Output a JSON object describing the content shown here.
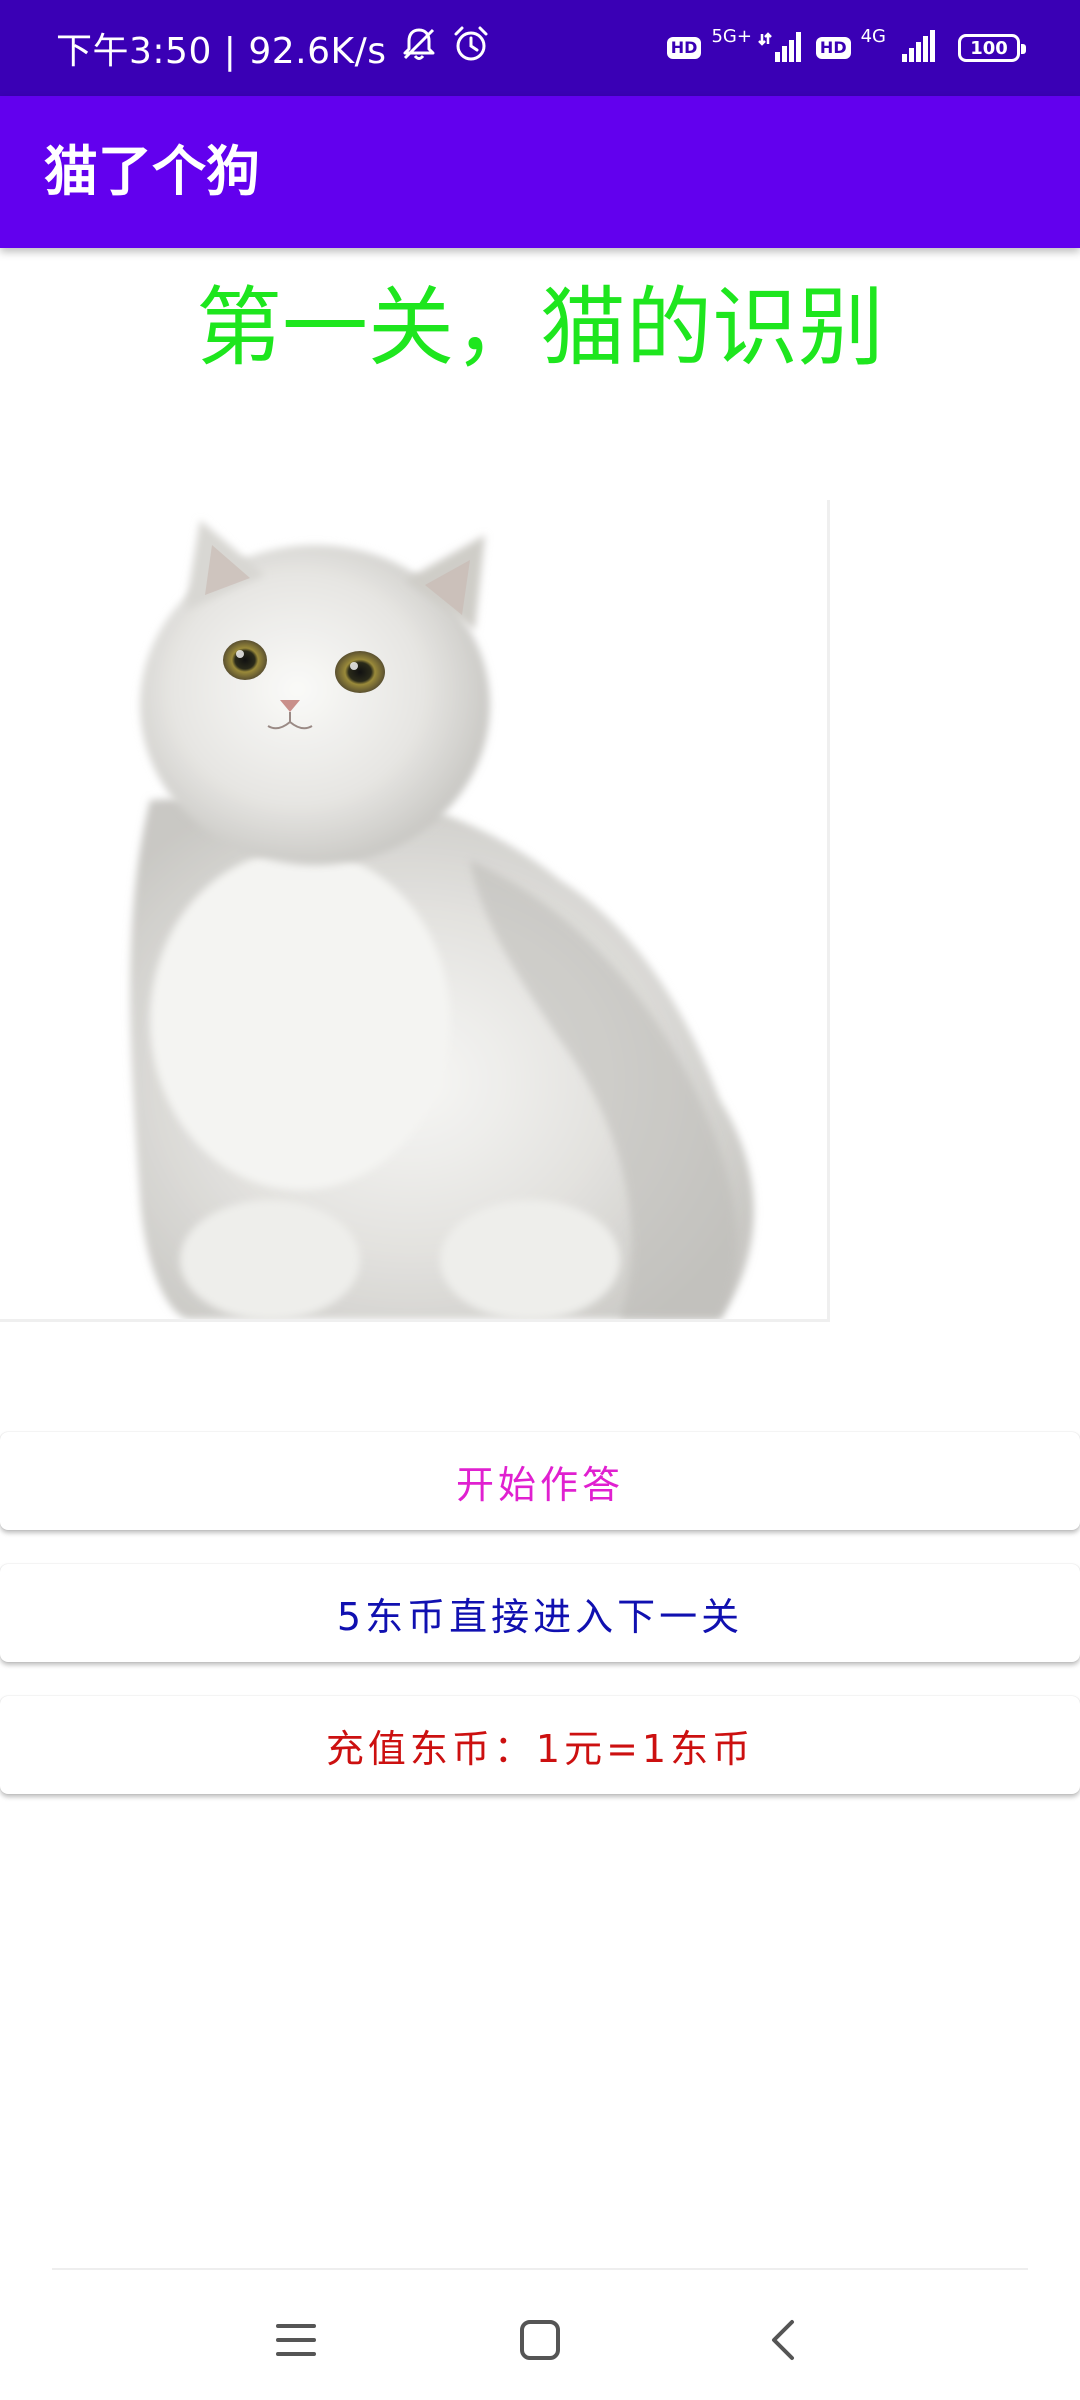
{
  "status_bar": {
    "time_speed": "下午3:50 | 92.6K/s",
    "icons": [
      "bell-off-icon",
      "alarm-icon"
    ],
    "hd1": "HD",
    "net1": "5G+",
    "hd2": "HD",
    "net2": "4G",
    "battery": "100"
  },
  "app_bar": {
    "title": "猫了个狗"
  },
  "main": {
    "level_title": "第一关，猫的识别",
    "image_subject": "cat-photo",
    "buttons": {
      "start": "开始作答",
      "skip": "5东币直接进入下一关",
      "recharge": "充值东币：1元=1东币"
    }
  },
  "colors": {
    "status_bar": "#3a00b5",
    "app_bar": "#6200ee",
    "level_title": "#1ee61e",
    "start_btn_text": "#e020d0",
    "skip_btn_text": "#1010b0",
    "recharge_btn_text": "#cc1010"
  },
  "nav_bar": {
    "icons": [
      "menu-icon",
      "home-icon",
      "back-icon"
    ]
  }
}
